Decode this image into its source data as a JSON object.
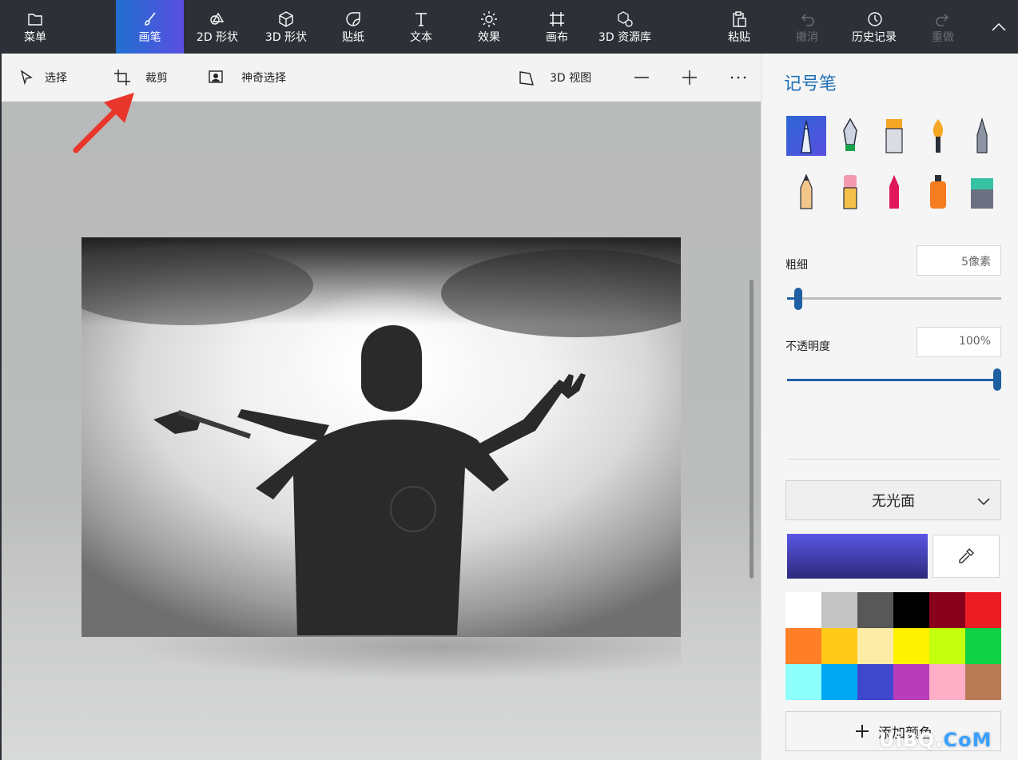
{
  "toolbar": {
    "menu": "菜单",
    "brushes": "画笔",
    "shapes_2d": "2D 形状",
    "shapes_3d": "3D 形状",
    "stickers": "贴纸",
    "text": "文本",
    "effects": "效果",
    "canvas": "画布",
    "library_3d": "3D 资源库",
    "paste": "粘贴",
    "undo": "撤消",
    "history": "历史记录",
    "redo": "重做"
  },
  "subbar": {
    "select": "选择",
    "crop": "裁剪",
    "magic_select": "神奇选择",
    "view_3d": "3D 视图"
  },
  "panel": {
    "title": "记号笔",
    "thickness_label": "粗细",
    "thickness_value": "5像素",
    "thickness_level": 0.06,
    "opacity_label": "不透明度",
    "opacity_value": "100%",
    "opacity_level": 1.0,
    "finish": "无光面",
    "current_color": "#4f4dd6",
    "add_color": "添加颜色",
    "brushes": [
      "marker-icon",
      "calligraphy-pen-icon",
      "oil-brush-icon",
      "watercolor-icon",
      "pixel-pen-icon",
      "pencil-icon",
      "eraser-icon",
      "crayon-icon",
      "spray-can-icon",
      "fill-bucket-icon"
    ],
    "palette": [
      "#ffffff",
      "#c3c3c3",
      "#585858",
      "#000000",
      "#88001b",
      "#ec1c24",
      "#ff7f27",
      "#ffca18",
      "#fdeca6",
      "#fff200",
      "#c4ff0e",
      "#0ed145",
      "#8cfffb",
      "#00a8f3",
      "#3f48cc",
      "#b83dba",
      "#ffaec8",
      "#b97a56"
    ]
  },
  "watermark": {
    "main": "UiBQ.",
    "accent": "CoM"
  },
  "colors": {
    "accent": "#1f6fb5",
    "toolbar_bg": "#2d3037",
    "annotation_arrow": "#e8362b"
  }
}
